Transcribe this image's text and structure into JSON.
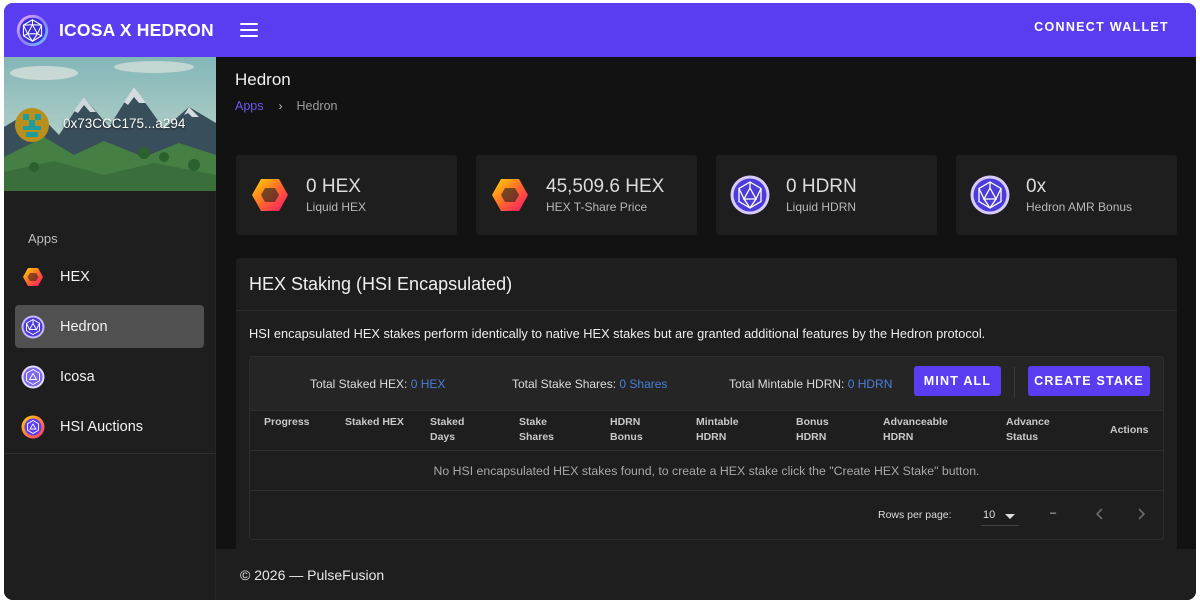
{
  "header": {
    "brand_title": "ICOSA X HEDRON",
    "connect_wallet_label": "CONNECT WALLET",
    "brand_color": "#5a3df0"
  },
  "sidebar": {
    "address": "0x73CCC175...a294",
    "section_heading": "Apps",
    "items": [
      {
        "label": "HEX",
        "icon": "hex-icon"
      },
      {
        "label": "Hedron",
        "icon": "hedron-icon",
        "active": true
      },
      {
        "label": "Icosa",
        "icon": "icosa-icon"
      },
      {
        "label": "HSI Auctions",
        "icon": "hsi-auctions-icon"
      }
    ]
  },
  "page": {
    "title": "Hedron",
    "breadcrumb": {
      "link": "Apps",
      "separator": "›",
      "current": "Hedron"
    }
  },
  "stats": [
    {
      "value": "0 HEX",
      "label": "Liquid HEX",
      "icon": "hex-icon"
    },
    {
      "value": "45,509.6 HEX",
      "label": "HEX T-Share Price",
      "icon": "hex-icon"
    },
    {
      "value": "0 HDRN",
      "label": "Liquid HDRN",
      "icon": "hedron-icon"
    },
    {
      "value": "0x",
      "label": "Hedron AMR Bonus",
      "icon": "hedron-icon"
    }
  ],
  "staking": {
    "title": "HEX Staking (HSI Encapsulated)",
    "description": "HSI encapsulated HEX stakes perform identically to native HEX stakes but are granted additional features by the Hedron protocol.",
    "totals": {
      "staked_hex_label": "Total Staked HEX:",
      "staked_hex_value": "0 HEX",
      "stake_shares_label": "Total Stake Shares:",
      "stake_shares_value": "0 Shares",
      "mintable_hdrn_label": "Total Mintable HDRN:",
      "mintable_hdrn_value": "0 HDRN"
    },
    "mint_all_label": "MINT ALL",
    "create_stake_label": "CREATE STAKE",
    "columns": [
      {
        "line1": "Progress",
        "line2": ""
      },
      {
        "line1": "Staked HEX",
        "line2": ""
      },
      {
        "line1": "Staked",
        "line2": "Days"
      },
      {
        "line1": "Stake",
        "line2": "Shares"
      },
      {
        "line1": "HDRN",
        "line2": "Bonus"
      },
      {
        "line1": "Mintable",
        "line2": "HDRN"
      },
      {
        "line1": "Bonus",
        "line2": "HDRN"
      },
      {
        "line1": "Advanceable",
        "line2": "HDRN"
      },
      {
        "line1": "Advance",
        "line2": "Status"
      },
      {
        "line1": "Actions",
        "line2": ""
      }
    ],
    "empty_message": "No HSI encapsulated HEX stakes found, to create a HEX stake click the \"Create HEX Stake\" button.",
    "pagination": {
      "rows_per_page_label": "Rows per page:",
      "rows_per_page_value": "10",
      "range_text": "–"
    }
  },
  "footer": {
    "text": "© 2026 — PulseFusion"
  }
}
